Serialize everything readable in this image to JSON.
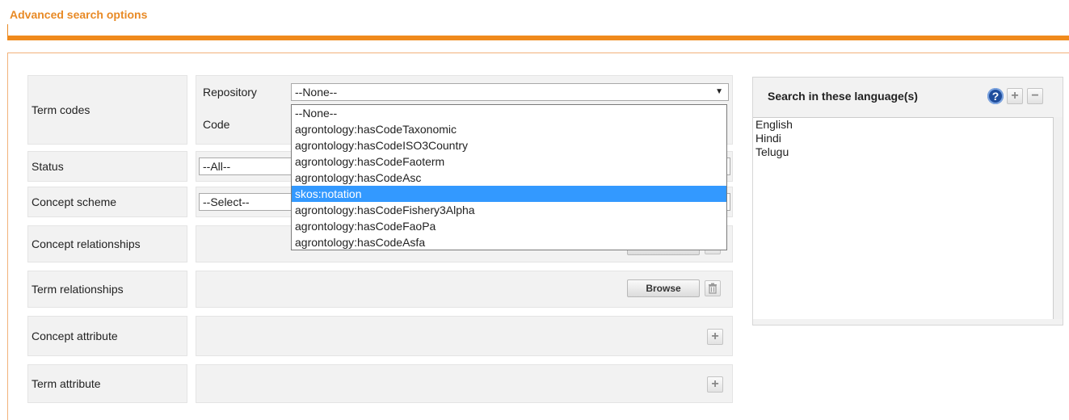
{
  "header": {
    "title": "Advanced search options"
  },
  "rows": {
    "term_codes": {
      "label": "Term codes",
      "repository_label": "Repository",
      "repository_value": "--None--",
      "code_label": "Code"
    },
    "status": {
      "label": "Status",
      "value": "--All--"
    },
    "concept_scheme": {
      "label": "Concept scheme",
      "value": "--Select--"
    },
    "concept_relationships": {
      "label": "Concept relationships"
    },
    "term_relationships": {
      "label": "Term relationships",
      "browse_label": "Browse"
    },
    "concept_attribute": {
      "label": "Concept attribute"
    },
    "term_attribute": {
      "label": "Term attribute"
    }
  },
  "repository_dropdown": {
    "options": [
      "--None--",
      "agrontology:hasCodeTaxonomic",
      "agrontology:hasCodeISO3Country",
      "agrontology:hasCodeFaoterm",
      "agrontology:hasCodeAsc",
      "skos:notation",
      "agrontology:hasCodeFishery3Alpha",
      "agrontology:hasCodeFaoPa",
      "agrontology:hasCodeAsfa"
    ],
    "highlighted_index": 5
  },
  "languages": {
    "title": "Search in these language(s)",
    "items": [
      "English",
      "Hindi",
      "Telugu"
    ]
  },
  "icons": {
    "help": "help-icon",
    "add": "plus-icon",
    "remove": "minus-icon",
    "delete": "trash-icon",
    "dropdown_arrow": "chevron-down-icon"
  },
  "colors": {
    "accent": "#f08a1c",
    "title": "#e88a26",
    "highlight": "#3399ff",
    "panel_bg": "#f2f2f2"
  }
}
